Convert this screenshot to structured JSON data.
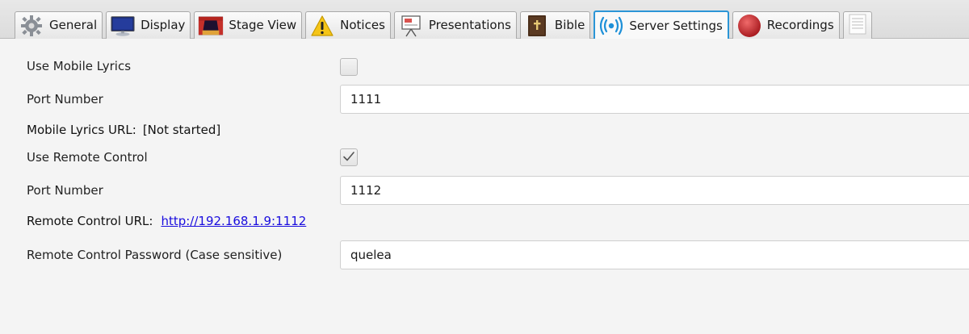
{
  "tabs": [
    {
      "label": "General",
      "icon": "gear-icon"
    },
    {
      "label": "Display",
      "icon": "monitor-icon"
    },
    {
      "label": "Stage View",
      "icon": "stage-icon"
    },
    {
      "label": "Notices",
      "icon": "warning-icon"
    },
    {
      "label": "Presentations",
      "icon": "presentation-icon"
    },
    {
      "label": "Bible",
      "icon": "bible-icon"
    },
    {
      "label": "Server Settings",
      "icon": "broadcast-icon",
      "active": true
    },
    {
      "label": "Recordings",
      "icon": "record-icon"
    }
  ],
  "mobile_lyrics": {
    "use_label": "Use Mobile Lyrics",
    "use_checked": false,
    "port_label": "Port Number",
    "port_value": "1111",
    "url_label": "Mobile Lyrics URL:",
    "url_value": "[Not started]"
  },
  "remote_control": {
    "use_label": "Use Remote Control",
    "use_checked": true,
    "port_label": "Port Number",
    "port_value": "1112",
    "url_label": "Remote Control URL:",
    "url_value": "http://192.168.1.9:1112",
    "password_label": "Remote Control Password (Case sensitive)",
    "password_value": "quelea"
  },
  "colors": {
    "active_tab_border": "#2b95d6",
    "link": "#1a0dde",
    "record_red": "#c0272d",
    "broadcast_blue": "#1e90d8"
  }
}
